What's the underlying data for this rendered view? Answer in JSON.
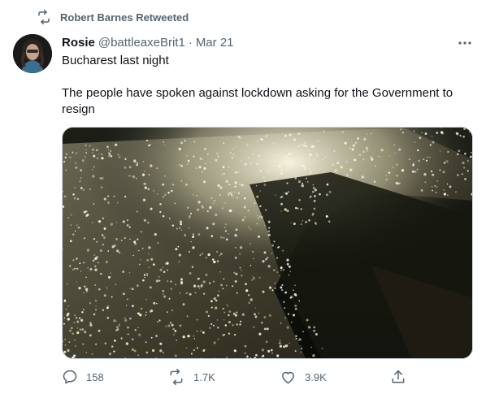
{
  "retweet_banner": {
    "icon": "retweet-icon",
    "text": "Robert Barnes Retweeted"
  },
  "tweet": {
    "author_name": "Rosie",
    "author_handle": "@battleaxeBrit1",
    "separator": "·",
    "date": "Mar 21",
    "more_icon": "more-horizontal-icon",
    "text_line1": "Bucharest last night",
    "text_line2": "The people have spoken against lockdown asking for the Government to resign"
  },
  "actions": {
    "reply": {
      "icon": "reply-icon",
      "count": "158"
    },
    "retweet": {
      "icon": "retweet-icon",
      "count": "1.7K"
    },
    "like": {
      "icon": "heart-icon",
      "count": "3.9K"
    },
    "share": {
      "icon": "share-icon"
    }
  },
  "colors": {
    "secondary_text": "#536471",
    "primary_text": "#0f1419",
    "border": "#cfd9de",
    "background": "#ffffff"
  }
}
